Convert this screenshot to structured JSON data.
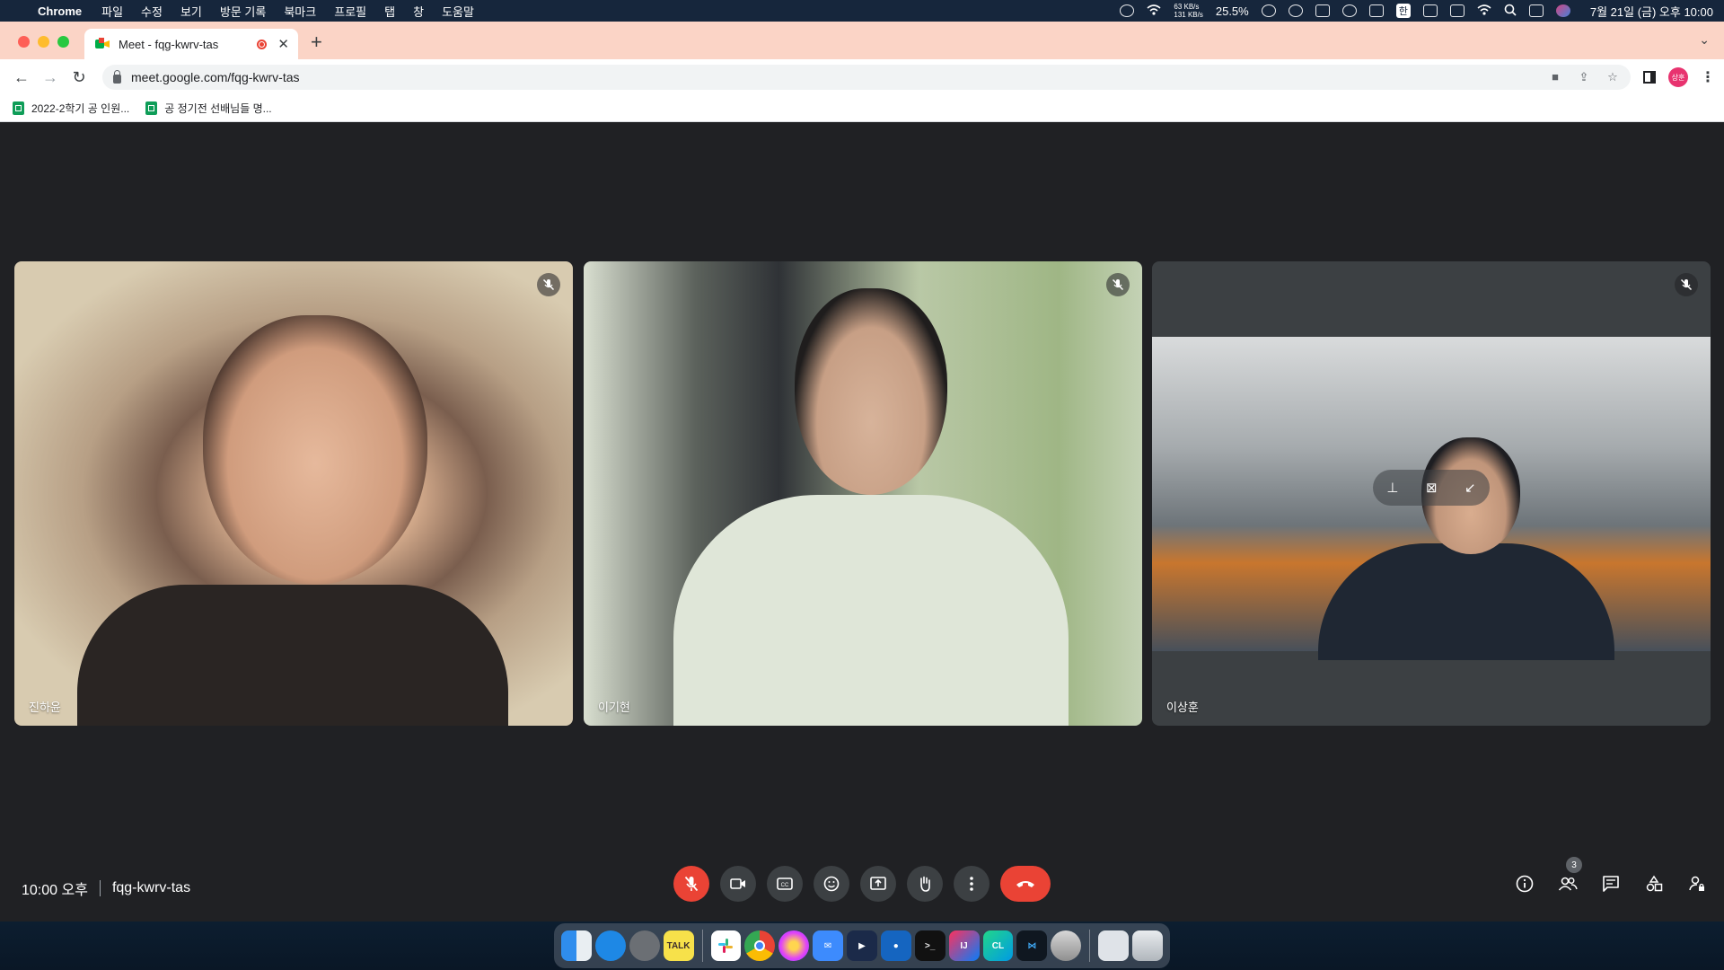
{
  "menubar": {
    "app": "Chrome",
    "menus": [
      "파일",
      "수정",
      "보기",
      "방문 기록",
      "북마크",
      "프로필",
      "탭",
      "창",
      "도움말"
    ],
    "net_up": "63 KB/s",
    "net_down": "131 KB/s",
    "cpu": "25.5%",
    "input_lang": "한",
    "clock": "7월 21일 (금) 오후 10:00"
  },
  "browser": {
    "tab_title": "Meet - fqg-kwrv-tas",
    "url": "meet.google.com/fqg-kwrv-tas",
    "profile_initials": "상훈",
    "bookmarks": [
      "2022-2학기 공 인원...",
      "공 정기전 선배님들 명..."
    ]
  },
  "participants": [
    {
      "name": "진하윤",
      "muted": true
    },
    {
      "name": "이기현",
      "muted": true
    },
    {
      "name": "이상훈",
      "muted": true
    }
  ],
  "meeting": {
    "time": "10:00 오후",
    "code": "fqg-kwrv-tas",
    "participant_count": "3"
  },
  "controls": {
    "mic": "mic-off-icon",
    "camera": "videocam-icon",
    "captions": "captions-icon",
    "reactions": "emoji-icon",
    "present": "present-screen-icon",
    "hand": "raise-hand-icon",
    "more": "more-options-icon",
    "leave": "call-end-icon"
  },
  "colors": {
    "meet_bg": "#202124",
    "button_bg": "#3c4043",
    "danger": "#ea4335",
    "tabstrip": "#fbd4c6"
  }
}
